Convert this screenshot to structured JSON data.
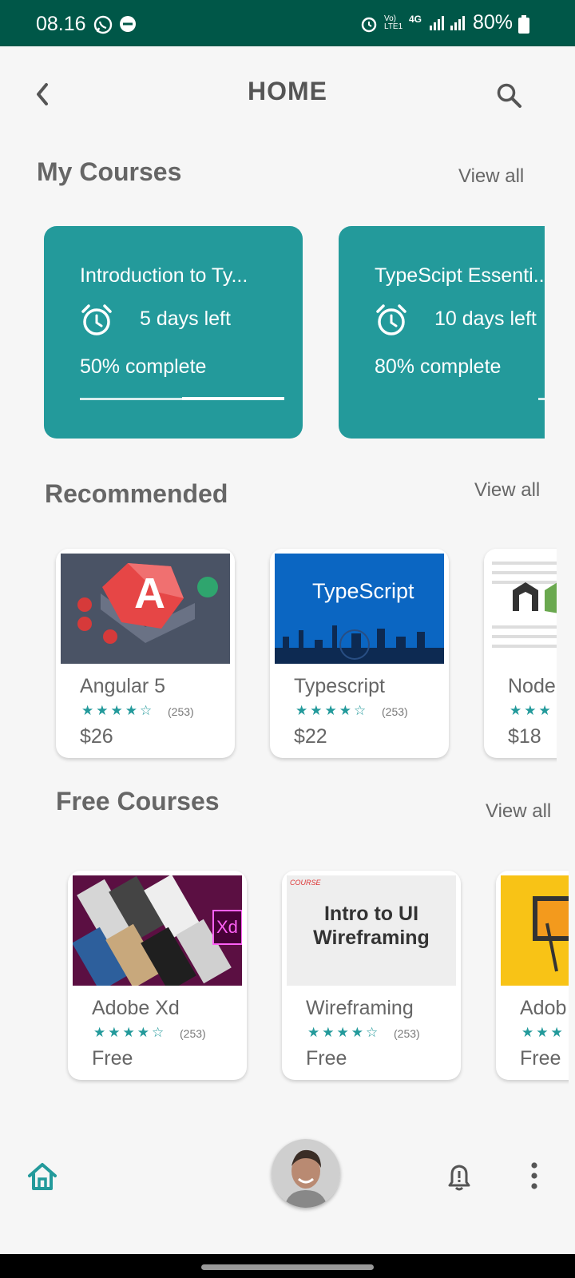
{
  "status_bar": {
    "time": "08.16",
    "battery": "80%",
    "network": "4G"
  },
  "header": {
    "title": "HOME"
  },
  "my_courses": {
    "title": "My Courses",
    "view_all": "View all",
    "items": [
      {
        "name": "Introduction to Ty...",
        "days_left": "5 days left",
        "progress_text": "50% complete",
        "progress": 0.5
      },
      {
        "name": "TypeScipt Essenti...",
        "days_left": "10 days left",
        "progress_text": "80% complete",
        "progress": 0.8
      }
    ]
  },
  "recommended": {
    "title": "Recommended",
    "view_all": "View all",
    "items": [
      {
        "name": "Angular 5",
        "stars": "★★★★☆",
        "rating_count": "(253)",
        "price": "$26",
        "rating": 4.5
      },
      {
        "name": "Typescript",
        "stars": "★★★★☆",
        "rating_count": "(253)",
        "price": "$22",
        "rating": 4.5,
        "thumb_text": "TypeScript"
      },
      {
        "name": "Node",
        "stars": "★★★",
        "rating_count": "",
        "price": "$18",
        "rating": 4.5
      }
    ]
  },
  "free_courses": {
    "title": "Free Courses",
    "view_all": "View all",
    "items": [
      {
        "name": "Adobe Xd",
        "stars": "★★★★☆",
        "rating_count": "(253)",
        "price": "Free",
        "rating": 4.5,
        "thumb_text": "Xd"
      },
      {
        "name": "Wireframing",
        "stars": "★★★★☆",
        "rating_count": "(253)",
        "price": "Free",
        "rating": 4.5,
        "thumb_text_1": "Intro to UI",
        "thumb_text_2": "Wireframing",
        "thumb_tag": "COURSE"
      },
      {
        "name": "Adob",
        "stars": "★★★",
        "rating_count": "",
        "price": "Free",
        "rating": 4.5
      }
    ]
  },
  "bottom_nav": {
    "home_icon": "home-icon",
    "profile_icon": "avatar",
    "notification_icon": "bell-icon",
    "more_icon": "more-icon"
  },
  "colors": {
    "primary": "#239a9b",
    "status_bar": "#005748",
    "background": "#f6f6f6"
  }
}
